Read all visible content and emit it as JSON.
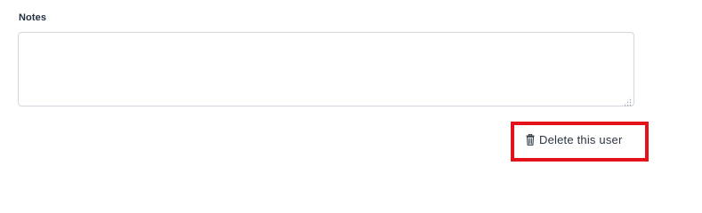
{
  "notes": {
    "label": "Notes",
    "value": "",
    "placeholder": ""
  },
  "actions": {
    "delete_label": "Delete this user",
    "delete_icon": "trash-icon"
  },
  "colors": {
    "highlight": "#e3121b",
    "label_text": "#1f2d3d",
    "link_text": "#2a3542",
    "field_border": "#d3d8de"
  }
}
